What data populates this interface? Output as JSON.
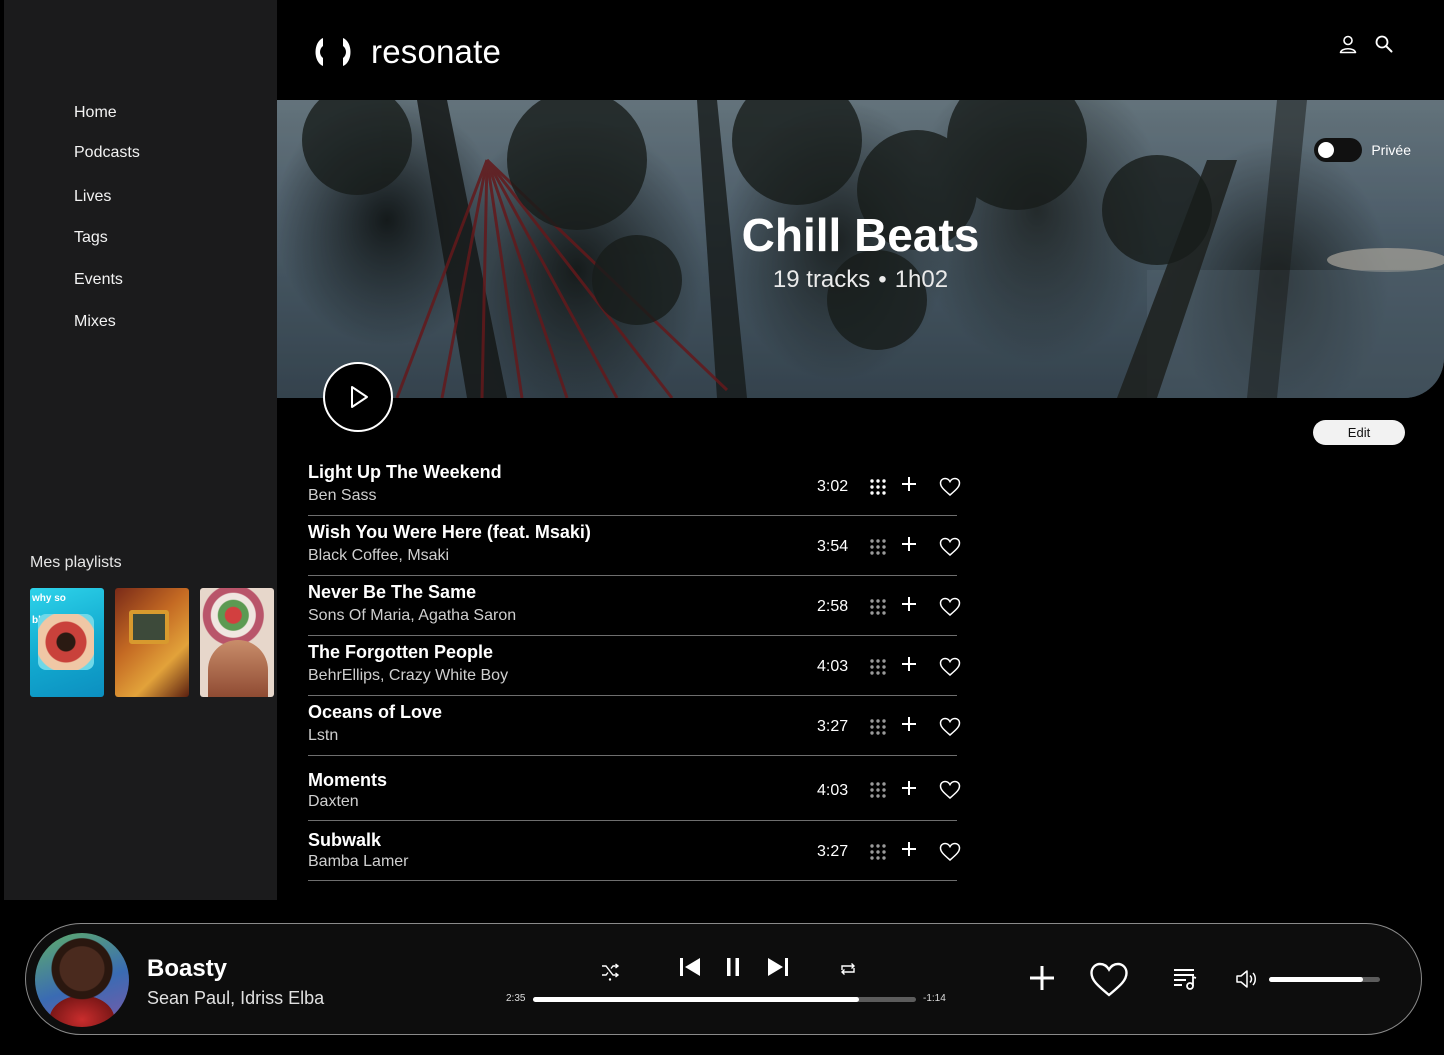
{
  "brand": {
    "name": "resonate"
  },
  "nav": [
    {
      "label": "Home"
    },
    {
      "label": "Podcasts"
    },
    {
      "label": "Lives"
    },
    {
      "label": "Tags"
    },
    {
      "label": "Events"
    },
    {
      "label": "Mixes"
    }
  ],
  "sidebar": {
    "playlists_title": "Mes playlists",
    "thumb1_text": "why so\nblue"
  },
  "header": {
    "icons": [
      "user-icon",
      "search-icon"
    ]
  },
  "playlist": {
    "title": "Chill Beats",
    "track_count": "19 tracks",
    "separator": "•",
    "duration": "1h02",
    "privacy_label": "Privée",
    "private": false,
    "edit_label": "Edit"
  },
  "tracks": [
    {
      "title": "Light Up The Weekend",
      "artist": "Ben Sass",
      "duration": "3:02"
    },
    {
      "title": "Wish You Were Here (feat. Msaki)",
      "artist": "Black Coffee, Msaki",
      "duration": "3:54"
    },
    {
      "title": "Never Be The Same",
      "artist": "Sons Of Maria, Agatha Saron",
      "duration": "2:58"
    },
    {
      "title": "The Forgotten People",
      "artist": "BehrEllips, Crazy White Boy",
      "duration": "4:03"
    },
    {
      "title": "Oceans of Love",
      "artist": "Lstn",
      "duration": "3:27"
    },
    {
      "title": "Moments",
      "artist": "Daxten",
      "duration": "4:03"
    },
    {
      "title": "Subwalk",
      "artist": "Bamba Lamer",
      "duration": "3:27"
    }
  ],
  "player": {
    "title": "Boasty",
    "artist": "Sean Paul, Idriss Elba",
    "elapsed": "2:35",
    "remaining": "-1:14",
    "progress": 0.85,
    "volume": 0.85,
    "controls": [
      "shuffle-icon",
      "previous-icon",
      "pause-icon",
      "next-icon",
      "repeat-icon",
      "add-icon",
      "heart-icon",
      "queue-icon",
      "volume-icon"
    ]
  }
}
